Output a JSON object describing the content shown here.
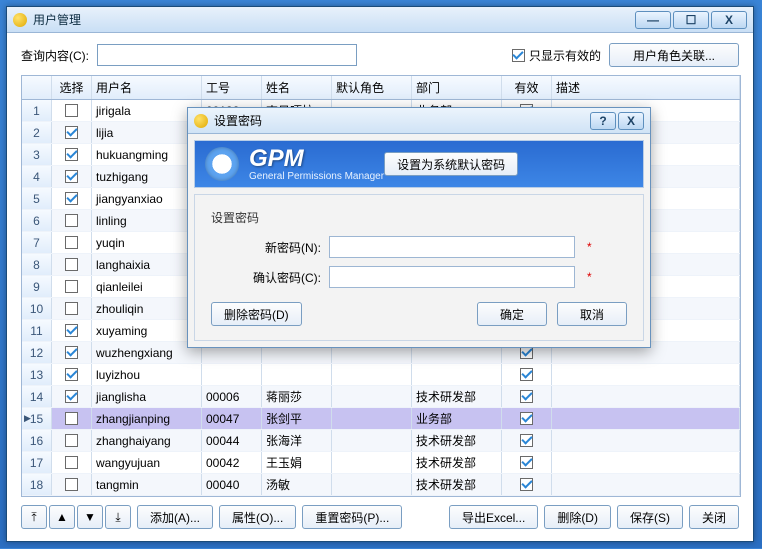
{
  "window": {
    "title": "用户管理"
  },
  "winbuttons": {
    "min": "—",
    "max": "☐",
    "close": "X"
  },
  "search": {
    "label": "查询内容(C):",
    "value": "",
    "only_valid_label": "只显示有效的",
    "only_valid_checked": true,
    "role_link_btn": "用户角色关联..."
  },
  "grid": {
    "headers": {
      "sel": "选择",
      "user": "用户名",
      "no": "工号",
      "name": "姓名",
      "role": "默认角色",
      "dept": "部门",
      "valid": "有效",
      "desc": "描述"
    },
    "rows": [
      {
        "n": "1",
        "sel": false,
        "user": "jirigala",
        "no": "00138",
        "name": "吉日嘎拉",
        "role": "",
        "dept": "业务部",
        "valid": true
      },
      {
        "n": "2",
        "sel": true,
        "user": "lijia",
        "no": "",
        "name": "",
        "role": "",
        "dept": "",
        "valid": true
      },
      {
        "n": "3",
        "sel": true,
        "user": "hukuangming",
        "no": "",
        "name": "",
        "role": "",
        "dept": "",
        "valid": true
      },
      {
        "n": "4",
        "sel": true,
        "user": "tuzhigang",
        "no": "",
        "name": "",
        "role": "",
        "dept": "",
        "valid": true
      },
      {
        "n": "5",
        "sel": true,
        "user": "jiangyanxiao",
        "no": "",
        "name": "",
        "role": "",
        "dept": "",
        "valid": true
      },
      {
        "n": "6",
        "sel": false,
        "user": "linling",
        "no": "",
        "name": "",
        "role": "",
        "dept": "",
        "valid": true
      },
      {
        "n": "7",
        "sel": false,
        "user": "yuqin",
        "no": "",
        "name": "",
        "role": "",
        "dept": "",
        "valid": true
      },
      {
        "n": "8",
        "sel": false,
        "user": "langhaixia",
        "no": "",
        "name": "",
        "role": "",
        "dept": "",
        "valid": true
      },
      {
        "n": "9",
        "sel": false,
        "user": "qianleilei",
        "no": "",
        "name": "",
        "role": "",
        "dept": "",
        "valid": true
      },
      {
        "n": "10",
        "sel": false,
        "user": "zhouliqin",
        "no": "",
        "name": "",
        "role": "",
        "dept": "",
        "valid": true
      },
      {
        "n": "11",
        "sel": true,
        "user": "xuyaming",
        "no": "",
        "name": "",
        "role": "",
        "dept": "",
        "valid": true
      },
      {
        "n": "12",
        "sel": true,
        "user": "wuzhengxiang",
        "no": "",
        "name": "",
        "role": "",
        "dept": "",
        "valid": true
      },
      {
        "n": "13",
        "sel": true,
        "user": "luyizhou",
        "no": "",
        "name": "",
        "role": "",
        "dept": "",
        "valid": true
      },
      {
        "n": "14",
        "sel": true,
        "user": "jianglisha",
        "no": "00006",
        "name": "蒋丽莎",
        "role": "",
        "dept": "技术研发部",
        "valid": true
      },
      {
        "n": "15",
        "sel": false,
        "user": "zhangjianping",
        "no": "00047",
        "name": "张剑平",
        "role": "",
        "dept": "业务部",
        "valid": true,
        "selected_row": true
      },
      {
        "n": "16",
        "sel": false,
        "user": "zhanghaiyang",
        "no": "00044",
        "name": "张海洋",
        "role": "",
        "dept": "技术研发部",
        "valid": true
      },
      {
        "n": "17",
        "sel": false,
        "user": "wangyujuan",
        "no": "00042",
        "name": "王玉娟",
        "role": "",
        "dept": "技术研发部",
        "valid": true
      },
      {
        "n": "18",
        "sel": false,
        "user": "tangmin",
        "no": "00040",
        "name": "汤敏",
        "role": "",
        "dept": "技术研发部",
        "valid": true
      }
    ]
  },
  "nav": {
    "first": "▴̄",
    "prev": "▴",
    "next": "▾",
    "last": "▾̱"
  },
  "footer": {
    "add": "添加(A)...",
    "props": "属性(O)...",
    "reset_pwd": "重置密码(P)...",
    "export": "导出Excel...",
    "delete": "删除(D)",
    "save": "保存(S)",
    "close": "关闭"
  },
  "dialog": {
    "title": "设置密码",
    "help": "?",
    "close": "X",
    "brand_big": "GPM",
    "brand_sub": "General Permissions Manager",
    "set_default_btn": "设置为系统默认密码",
    "group_label": "设置密码",
    "new_pwd_label": "新密码(N):",
    "confirm_pwd_label": "确认密码(C):",
    "new_pwd_value": "",
    "confirm_pwd_value": "",
    "required_mark": "*",
    "delete_pwd_btn": "删除密码(D)",
    "ok": "确定",
    "cancel": "取消"
  }
}
